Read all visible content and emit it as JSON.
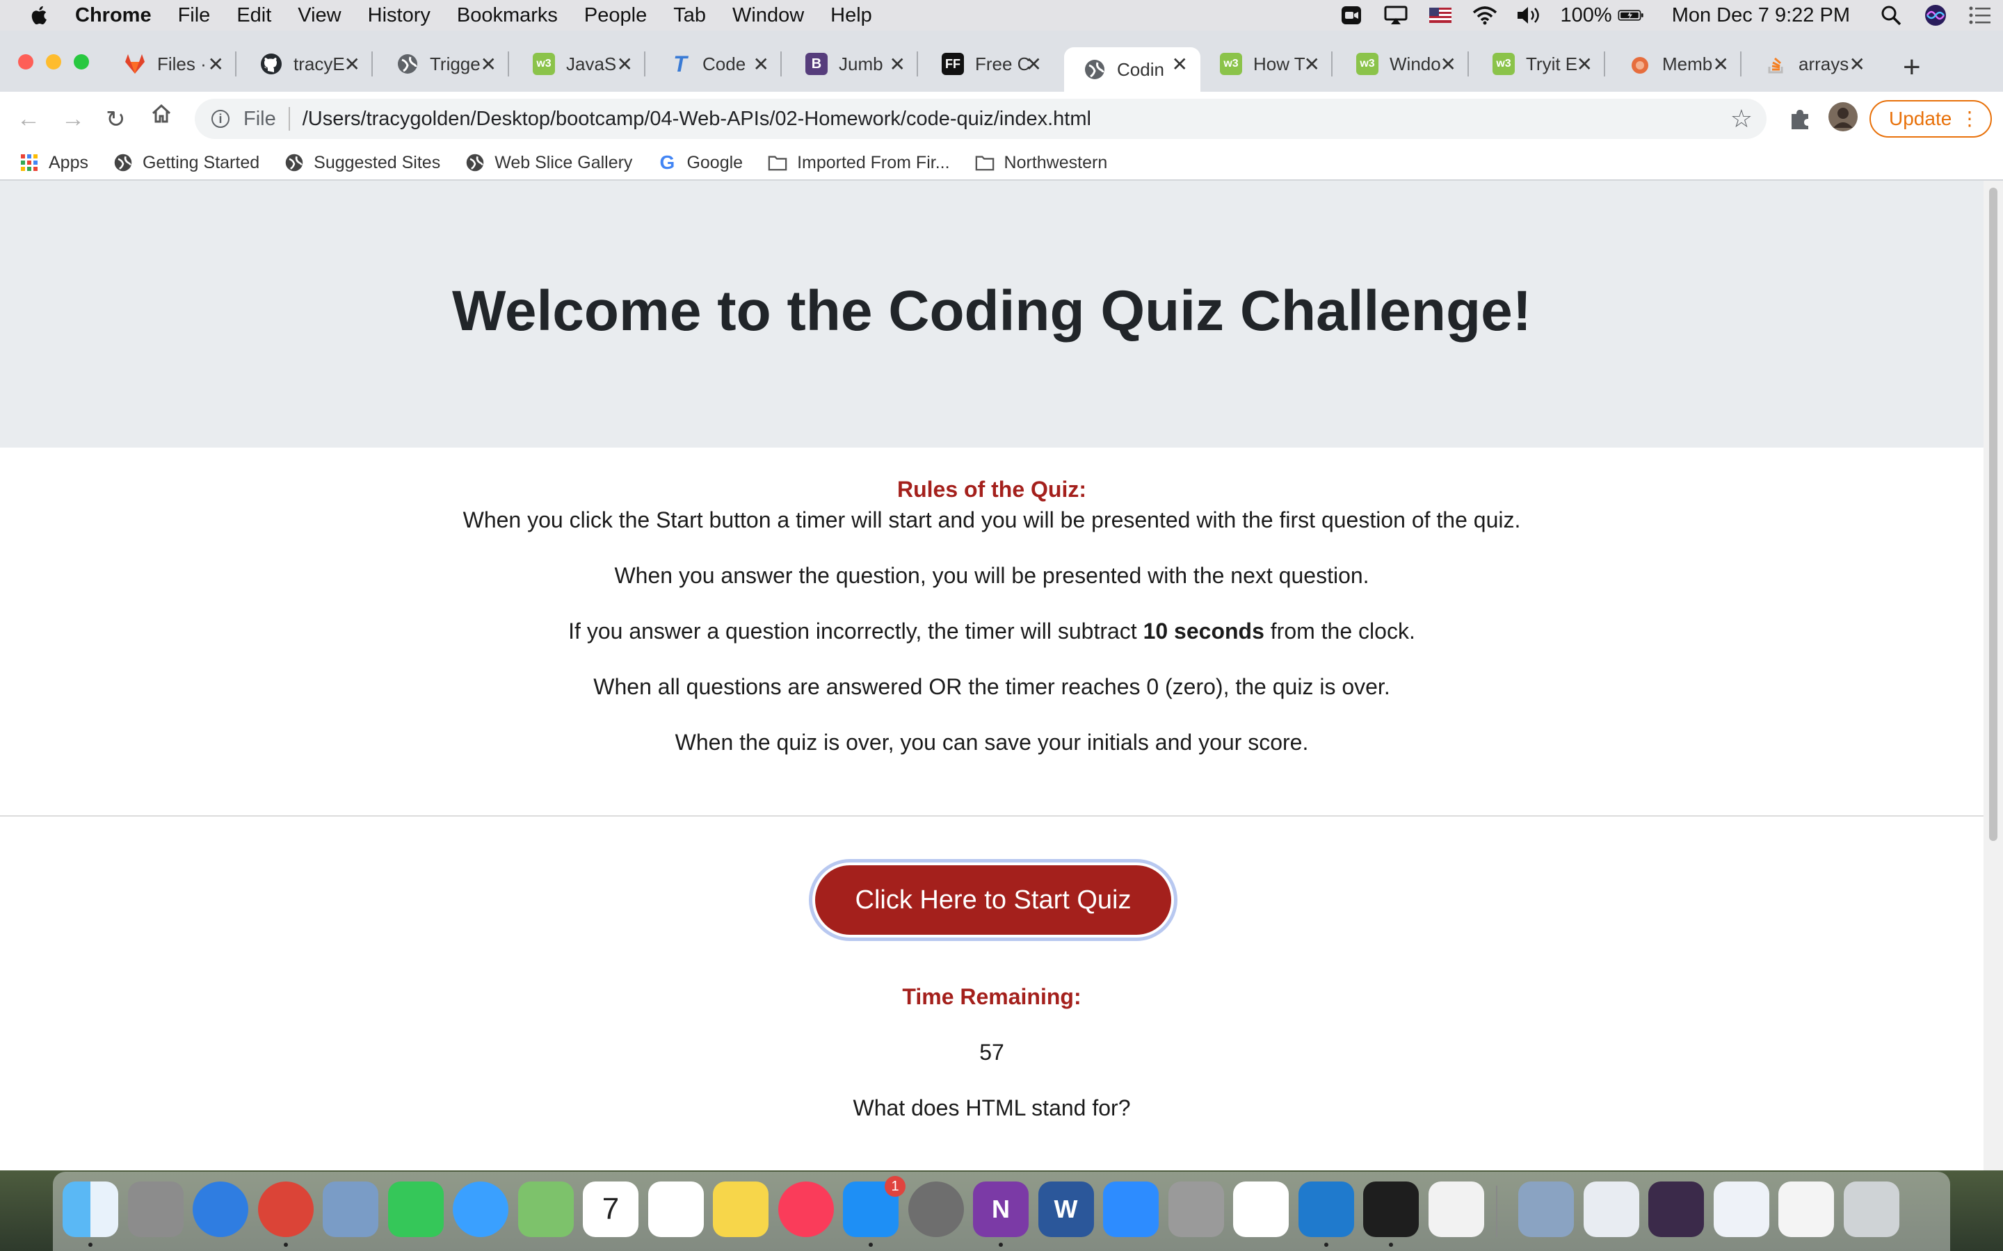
{
  "menubar": {
    "app_name": "Chrome",
    "items": [
      "File",
      "Edit",
      "View",
      "History",
      "Bookmarks",
      "People",
      "Tab",
      "Window",
      "Help"
    ],
    "battery": "100%",
    "datetime": "Mon Dec 7  9:22 PM"
  },
  "tabs": [
    {
      "label": "Files ·",
      "favicon": "gitlab-icon",
      "color": "#e24329"
    },
    {
      "label": "tracyE",
      "favicon": "github-icon",
      "color": "#24292e"
    },
    {
      "label": "Trigge",
      "favicon": "globe-icon",
      "color": "#5f6368"
    },
    {
      "label": "JavaS",
      "favicon": "w3schools-icon",
      "color": "#8bc34a"
    },
    {
      "label": "Code",
      "favicon": "typora-icon",
      "color": "#3a7bd5"
    },
    {
      "label": "Jumb",
      "favicon": "bootstrap-icon",
      "color": "#563d7c"
    },
    {
      "label": "Free C",
      "favicon": "ff-icon",
      "color": "#111111"
    },
    {
      "label": "Codin",
      "favicon": "globe-icon",
      "color": "#5f6368",
      "active": true
    },
    {
      "label": "How T",
      "favicon": "w3schools-icon",
      "color": "#8bc34a"
    },
    {
      "label": "Windo",
      "favicon": "w3schools-icon",
      "color": "#8bc34a"
    },
    {
      "label": "Tryit E",
      "favicon": "w3schools-icon",
      "color": "#8bc34a"
    },
    {
      "label": "Memb",
      "favicon": "mdn-icon",
      "color": "#e66d3d"
    },
    {
      "label": "arrays",
      "favicon": "stackoverflow-icon",
      "color": "#f48024"
    }
  ],
  "toolbar": {
    "scheme": "File",
    "url": "/Users/tracygolden/Desktop/bootcamp/04-Web-APIs/02-Homework/code-quiz/index.html",
    "update_label": "Update"
  },
  "bookmarks": [
    {
      "label": "Apps",
      "icon": "apps-grid-icon"
    },
    {
      "label": "Getting Started",
      "icon": "globe-icon"
    },
    {
      "label": "Suggested Sites",
      "icon": "globe-icon"
    },
    {
      "label": "Web Slice Gallery",
      "icon": "globe-icon"
    },
    {
      "label": "Google",
      "icon": "google-icon"
    },
    {
      "label": "Imported From Fir...",
      "icon": "folder-icon"
    },
    {
      "label": "Northwestern",
      "icon": "folder-icon"
    }
  ],
  "page": {
    "title": "Welcome to the Coding Quiz Challenge!",
    "rules_heading": "Rules of the Quiz:",
    "rules": [
      "When you click the Start button a timer will start and you will be presented with the first question of the quiz.",
      "When you answer the question, you will be presented with the next question.",
      "If you answer a question incorrectly, the timer will subtract",
      "10 seconds",
      "from the clock.",
      "When all questions are answered OR the timer reaches 0 (zero), the quiz is over.",
      "When the quiz is over, you can save your initials and your score."
    ],
    "start_button": "Click Here to Start Quiz",
    "time_heading": "Time Remaining:",
    "time_value": "57",
    "question": "What does HTML stand for?"
  },
  "colors": {
    "accent": "#a4201c",
    "jumbotron_bg": "#e9ecef",
    "update_orange": "#e8710a"
  },
  "dock": [
    {
      "name": "finder-icon",
      "color": "#4aa3f0"
    },
    {
      "name": "launchpad-icon",
      "color": "#8c8c8c"
    },
    {
      "name": "safari-icon",
      "color": "#2f7de1"
    },
    {
      "name": "chrome-icon",
      "color": "#db4437"
    },
    {
      "name": "preview-icon",
      "color": "#7a9cc6"
    },
    {
      "name": "facetime-icon",
      "color": "#35c759"
    },
    {
      "name": "messages-icon",
      "color": "#3aa0ff"
    },
    {
      "name": "maps-icon",
      "color": "#7dc26b"
    },
    {
      "name": "calendar-icon",
      "color": "#ffffff",
      "text": "7"
    },
    {
      "name": "reminders-icon",
      "color": "#ffffff"
    },
    {
      "name": "notes-icon",
      "color": "#f7d64a"
    },
    {
      "name": "music-icon",
      "color": "#fa3c5a"
    },
    {
      "name": "app-store-icon",
      "color": "#1e8ff5",
      "badge": "1"
    },
    {
      "name": "system-preferences-icon",
      "color": "#6e6e6e"
    },
    {
      "name": "onenote-icon",
      "color": "#7b3aa6",
      "text": "N"
    },
    {
      "name": "word-icon",
      "color": "#2b579a",
      "text": "W"
    },
    {
      "name": "zoom-icon",
      "color": "#2d8cff"
    },
    {
      "name": "calculator-icon",
      "color": "#9a9a9a"
    },
    {
      "name": "slack-icon",
      "color": "#ffffff"
    },
    {
      "name": "vscode-icon",
      "color": "#1f7acd"
    },
    {
      "name": "terminal-icon",
      "color": "#1e1e1e"
    },
    {
      "name": "textedit-icon",
      "color": "#f2f2f2"
    },
    {
      "name": "image-capture-icon",
      "color": "#8aa3c2"
    },
    {
      "name": "window-thumb-icon",
      "color": "#e8ecf2"
    },
    {
      "name": "window-thumb-icon",
      "color": "#3b2a4a"
    },
    {
      "name": "window-thumb-icon",
      "color": "#eef2f8"
    },
    {
      "name": "window-thumb-icon",
      "color": "#f4f4f4"
    },
    {
      "name": "trash-icon",
      "color": "#cfd3d6"
    }
  ]
}
